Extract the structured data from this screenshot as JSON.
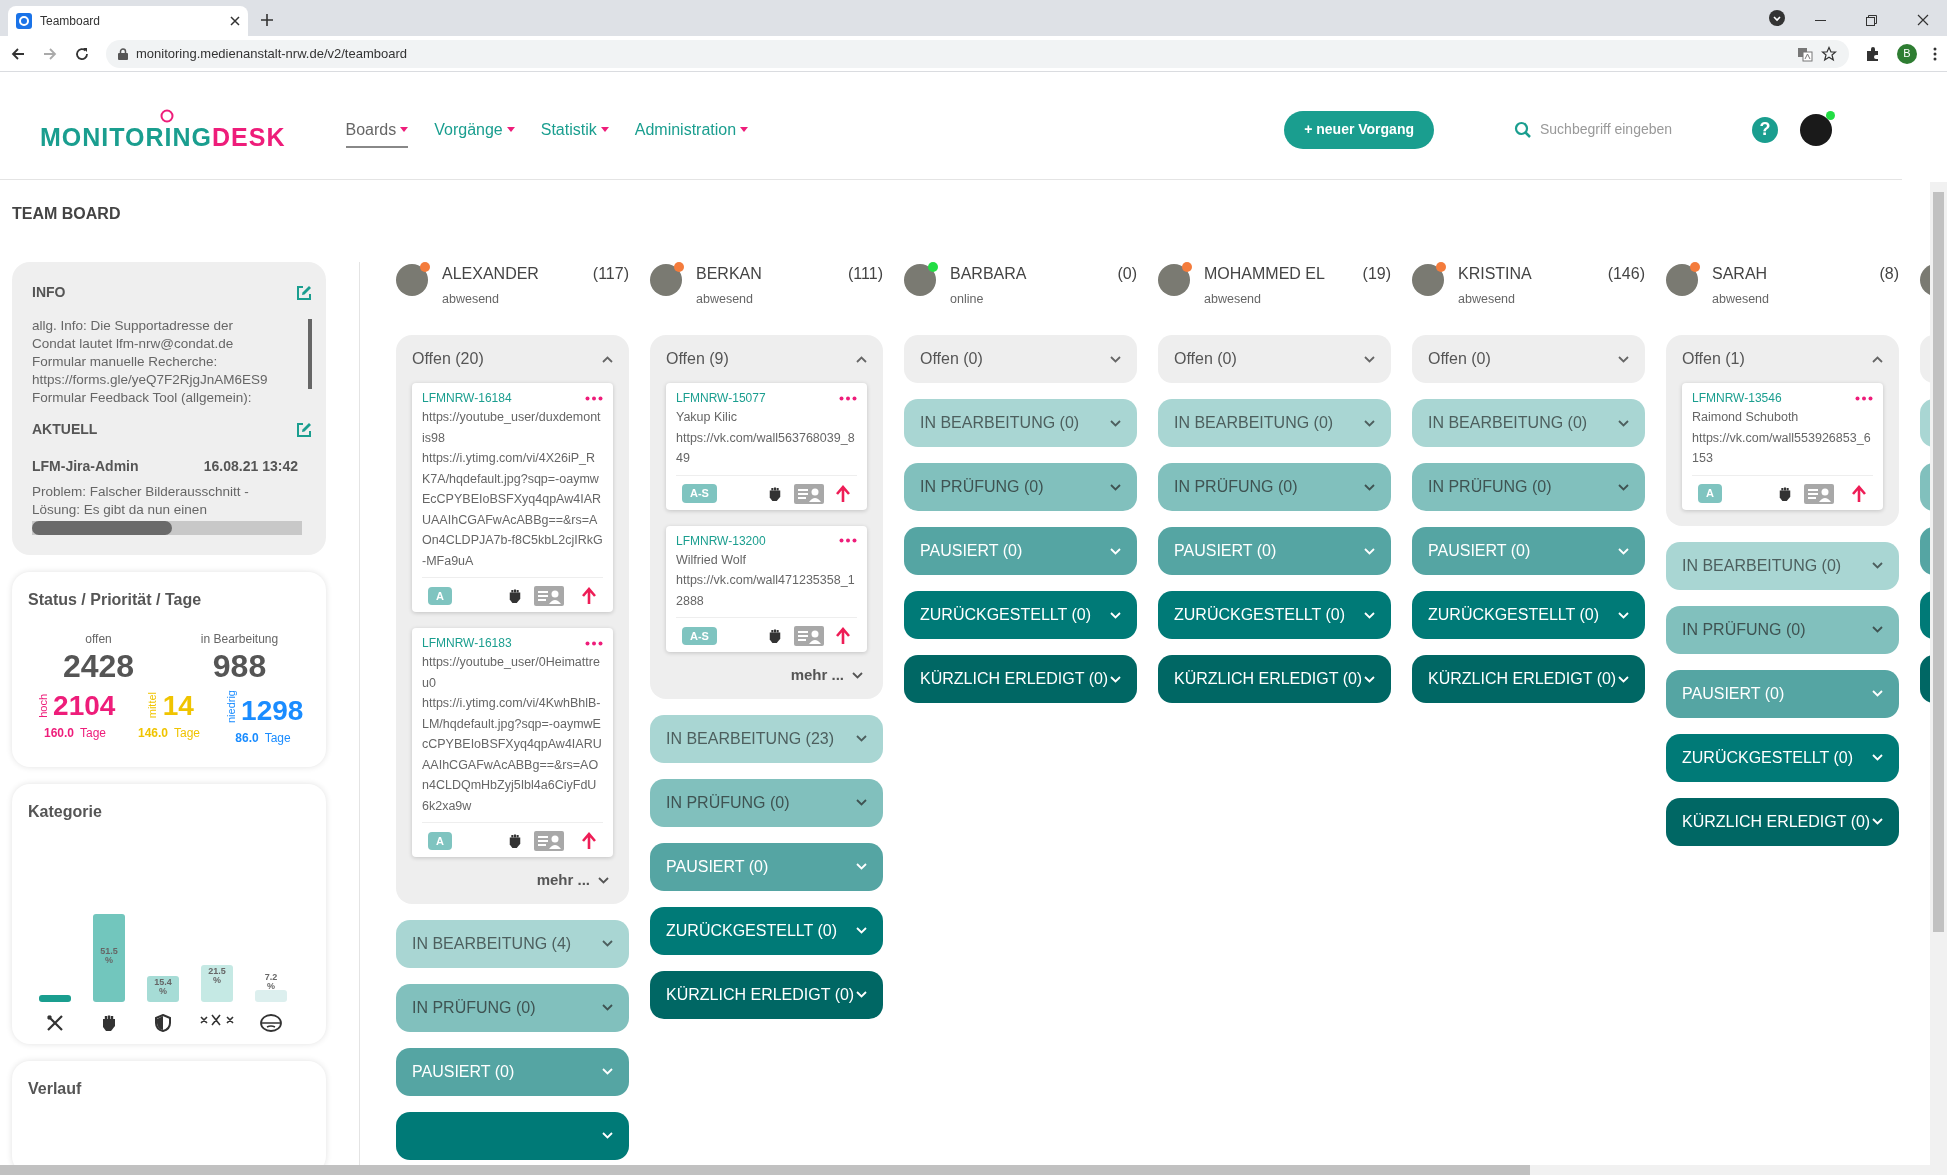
{
  "browser": {
    "tab_title": "Teamboard",
    "url": "monitoring.medienanstalt-nrw.de/v2/teamboard",
    "profile_initial": "B"
  },
  "header": {
    "logo": {
      "primary": "MONITORING",
      "accent": "DESK"
    },
    "nav": [
      {
        "label": "Boards",
        "selected": true
      },
      {
        "label": "Vorgänge",
        "selected": false
      },
      {
        "label": "Statistik",
        "selected": false
      },
      {
        "label": "Administration",
        "selected": false
      }
    ],
    "new_button": "+ neuer Vorgang",
    "search": {
      "placeholder": "Suchbegriff eingeben"
    },
    "help": "?"
  },
  "page_title": "TEAM BOARD",
  "sidebar": {
    "info": {
      "title": "INFO",
      "text": "allg. Info: Die Supportadresse der\nCondat lautet lfm-nrw@condat.de\nFormular manuelle Recherche:\nhttps://forms.gle/yeQ7F2RjgJnAM6ES9\nFormular Feedback Tool (allgemein):"
    },
    "aktuell": {
      "title": "AKTUELL",
      "author": "LFM-Jira-Admin",
      "time": "16.08.21 13:42",
      "text": "Problem: Falscher Bilderausschnitt -\nLösung: Es gibt da nun einen"
    },
    "status": {
      "title": "Status / Priorität / Tage",
      "totals": [
        {
          "label": "offen",
          "value": "2428"
        },
        {
          "label": "in Bearbeitung",
          "value": "988"
        }
      ],
      "priorities": [
        {
          "label": "hoch",
          "value": "2104",
          "days": "160.0",
          "unit": "Tage",
          "color": "#ee1d7a"
        },
        {
          "label": "mittel",
          "value": "14",
          "days": "146.0",
          "unit": "Tage",
          "color": "#f0c400"
        },
        {
          "label": "niedrig",
          "value": "1298",
          "days": "86.0",
          "unit": "Tage",
          "color": "#1a8cff"
        }
      ]
    },
    "kategorie": {
      "title": "Kategorie",
      "bar_labels": [
        "51.5 %",
        "15.4 %",
        "21.5 %",
        "7.2 %"
      ]
    },
    "verlauf": {
      "title": "Verlauf"
    }
  },
  "columns": [
    {
      "name": "ALEXANDER",
      "count": "(117)",
      "presence": "abwesend",
      "online": false,
      "groups": [
        {
          "kind": "offen",
          "label": "Offen (20)",
          "expanded": true,
          "more": "mehr ...",
          "cards": [
            {
              "id": "LFMNRW-16184",
              "lines": [
                "https://youtube_user/duxdemontis98",
                "https://i.ytimg.com/vi/4X26iP_RK7A/hqdefault.jpg?sqp=-oaymwEcCPYBEIoBSFXyq4qpAw4IARUAAIhCGAFwAcABBg==&rs=AOn4CLDPJA7b-f8C5kbL2cjIRkG-MFa9uA"
              ],
              "badge": "A"
            },
            {
              "id": "LFMNRW-16183",
              "lines": [
                "https://youtube_user/0Heimattreu0",
                "https://i.ytimg.com/vi/4KwhBhlB-LM/hqdefault.jpg?sqp=-oaymwEcCPYBEIoBSFXyq4qpAw4IARUAAIhCGAFwAcABBg==&rs=AOn4CLDQmHbZyj5Ibl4a6CiyFdU6k2xa9w"
              ],
              "badge": "A"
            }
          ]
        },
        {
          "kind": "bearbeitung",
          "label": "IN BEARBEITUNG (4)",
          "expanded": false
        },
        {
          "kind": "pruefung",
          "label": "IN PRÜFUNG (0)",
          "expanded": false
        },
        {
          "kind": "pausiert",
          "label": "PAUSIERT (0)",
          "expanded": false
        },
        {
          "kind": "zurueckgestellt",
          "expanded": false
        }
      ]
    },
    {
      "name": "BERKAN",
      "count": "(111)",
      "presence": "abwesend",
      "online": false,
      "groups": [
        {
          "kind": "offen",
          "label": "Offen (9)",
          "expanded": true,
          "more": "mehr ...",
          "cards": [
            {
              "id": "LFMNRW-15077",
              "lines": [
                "Yakup Kilic",
                "https://vk.com/wall563768039_849"
              ],
              "badge": "A-S"
            },
            {
              "id": "LFMNRW-13200",
              "lines": [
                "Wilfried Wolf",
                "https://vk.com/wall471235358_12888"
              ],
              "badge": "A-S"
            }
          ]
        },
        {
          "kind": "bearbeitung",
          "label": "IN BEARBEITUNG (23)",
          "expanded": false
        },
        {
          "kind": "pruefung",
          "label": "IN PRÜFUNG (0)",
          "expanded": false
        },
        {
          "kind": "pausiert",
          "label": "PAUSIERT (0)",
          "expanded": false
        },
        {
          "kind": "zurueckgestellt",
          "label": "ZURÜCKGESTELLT (0)",
          "expanded": false
        },
        {
          "kind": "erledigt",
          "label": "KÜRZLICH ERLEDIGT (0)",
          "expanded": false
        }
      ]
    },
    {
      "name": "BARBARA",
      "count": "(0)",
      "presence": "online",
      "online": true,
      "groups": [
        {
          "kind": "offen",
          "label": "Offen (0)",
          "expanded": false
        },
        {
          "kind": "bearbeitung",
          "label": "IN BEARBEITUNG (0)",
          "expanded": false
        },
        {
          "kind": "pruefung",
          "label": "IN PRÜFUNG (0)",
          "expanded": false
        },
        {
          "kind": "pausiert",
          "label": "PAUSIERT (0)",
          "expanded": false
        },
        {
          "kind": "zurueckgestellt",
          "label": "ZURÜCKGESTELLT (0)",
          "expanded": false
        },
        {
          "kind": "erledigt",
          "label": "KÜRZLICH ERLEDIGT (0)",
          "expanded": false
        }
      ]
    },
    {
      "name": "MOHAMMED EL",
      "count": "(19)",
      "presence": "abwesend",
      "online": false,
      "groups": [
        {
          "kind": "offen",
          "label": "Offen (0)",
          "expanded": false
        },
        {
          "kind": "bearbeitung",
          "label": "IN BEARBEITUNG (0)",
          "expanded": false
        },
        {
          "kind": "pruefung",
          "label": "IN PRÜFUNG (0)",
          "expanded": false
        },
        {
          "kind": "pausiert",
          "label": "PAUSIERT (0)",
          "expanded": false
        },
        {
          "kind": "zurueckgestellt",
          "label": "ZURÜCKGESTELLT (0)",
          "expanded": false
        },
        {
          "kind": "erledigt",
          "label": "KÜRZLICH ERLEDIGT (0)",
          "expanded": false
        }
      ]
    },
    {
      "name": "KRISTINA",
      "count": "(146)",
      "presence": "abwesend",
      "online": false,
      "groups": [
        {
          "kind": "offen",
          "label": "Offen (0)",
          "expanded": false
        },
        {
          "kind": "bearbeitung",
          "label": "IN BEARBEITUNG (0)",
          "expanded": false
        },
        {
          "kind": "pruefung",
          "label": "IN PRÜFUNG (0)",
          "expanded": false
        },
        {
          "kind": "pausiert",
          "label": "PAUSIERT (0)",
          "expanded": false
        },
        {
          "kind": "zurueckgestellt",
          "label": "ZURÜCKGESTELLT (0)",
          "expanded": false
        },
        {
          "kind": "erledigt",
          "label": "KÜRZLICH ERLEDIGT (0)",
          "expanded": false
        }
      ]
    },
    {
      "name": "SARAH",
      "count": "(8)",
      "presence": "abwesend",
      "online": false,
      "groups": [
        {
          "kind": "offen",
          "label": "Offen (1)",
          "expanded": true,
          "cards": [
            {
              "id": "LFMNRW-13546",
              "lines": [
                "Raimond Schuboth",
                "https://vk.com/wall553926853_6153"
              ],
              "badge": "A"
            }
          ]
        },
        {
          "kind": "bearbeitung",
          "label": "IN BEARBEITUNG (0)",
          "expanded": false
        },
        {
          "kind": "pruefung",
          "label": "IN PRÜFUNG (0)",
          "expanded": false
        },
        {
          "kind": "pausiert",
          "label": "PAUSIERT (0)",
          "expanded": false
        },
        {
          "kind": "zurueckgestellt",
          "label": "ZURÜCKGESTELLT (0)",
          "expanded": false
        },
        {
          "kind": "erledigt",
          "label": "KÜRZLICH ERLEDIGT (0)",
          "expanded": false
        }
      ]
    },
    {
      "groups": [
        {
          "kind": "offen",
          "expanded": false
        },
        {
          "kind": "bearbeitung",
          "expanded": false
        },
        {
          "kind": "pruefung",
          "expanded": false
        },
        {
          "kind": "pausiert",
          "expanded": false
        },
        {
          "kind": "zurueckgestellt",
          "expanded": false
        },
        {
          "kind": "erledigt",
          "expanded": false
        }
      ]
    }
  ]
}
